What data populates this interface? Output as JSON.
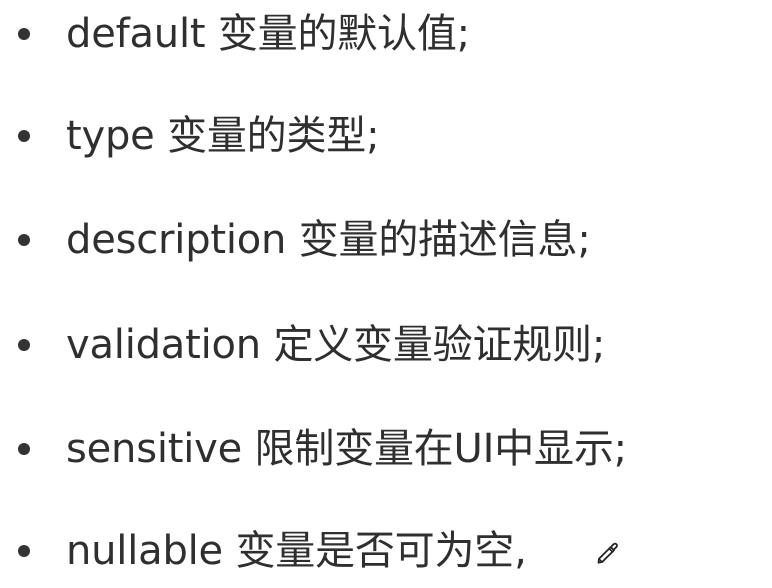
{
  "items": [
    {
      "text": "default 变量的默认值;"
    },
    {
      "text": "type 变量的类型;"
    },
    {
      "text": "description 变量的描述信息;"
    },
    {
      "text": "validation  定义变量验证规则;"
    },
    {
      "text": "sensitive 限制变量在UI中显示;"
    },
    {
      "text": "nullable 变量是否可为空,"
    }
  ],
  "icons": {
    "cursor": "pencil-icon"
  }
}
